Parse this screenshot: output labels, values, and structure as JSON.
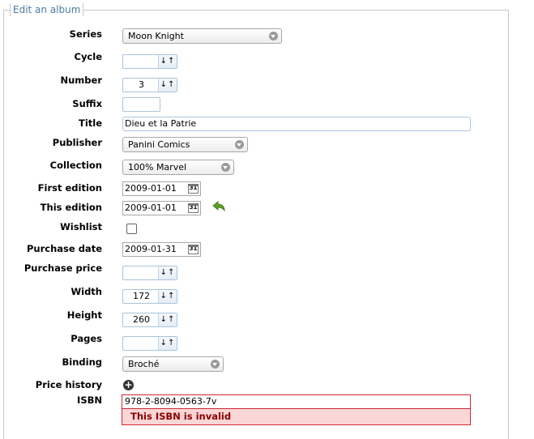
{
  "form": {
    "legend": "Edit an album",
    "fields": {
      "series": {
        "label": "Series",
        "value": "Moon Knight",
        "icon": "chevron-down-icon"
      },
      "cycle": {
        "label": "Cycle",
        "value": "",
        "spin": "↓↑"
      },
      "number": {
        "label": "Number",
        "value": "3",
        "spin": "↓↑"
      },
      "suffix": {
        "label": "Suffix",
        "value": ""
      },
      "title": {
        "label": "Title",
        "value": "Dieu et la Patrie"
      },
      "publisher": {
        "label": "Publisher",
        "value": "Panini Comics"
      },
      "collection": {
        "label": "Collection",
        "value": "100% Marvel"
      },
      "first_edition": {
        "label": "First edition",
        "value": "2009-01-01",
        "cal": "31"
      },
      "this_edition": {
        "label": "This edition",
        "value": "2009-01-01",
        "cal": "31"
      },
      "wishlist": {
        "label": "Wishlist",
        "checked": false
      },
      "purchase_date": {
        "label": "Purchase date",
        "value": "2009-01-31",
        "cal": "31"
      },
      "purchase_price": {
        "label": "Purchase price",
        "value": "",
        "spin": "↓↑"
      },
      "width": {
        "label": "Width",
        "value": "172",
        "spin": "↓↑"
      },
      "height": {
        "label": "Height",
        "value": "260",
        "spin": "↓↑"
      },
      "pages": {
        "label": "Pages",
        "value": "",
        "spin": "↓↑"
      },
      "binding": {
        "label": "Binding",
        "value": "Broché"
      },
      "price_history": {
        "label": "Price history",
        "add": "+"
      },
      "isbn": {
        "label": "ISBN",
        "value": "978-2-8094-0563-7v",
        "error": "This ISBN is invalid"
      }
    }
  },
  "colors": {
    "legend": "#4d7a9d",
    "error_bg": "#fbd6d6",
    "error_border": "#cc2a36",
    "revert_icon": "#5aa01e"
  }
}
